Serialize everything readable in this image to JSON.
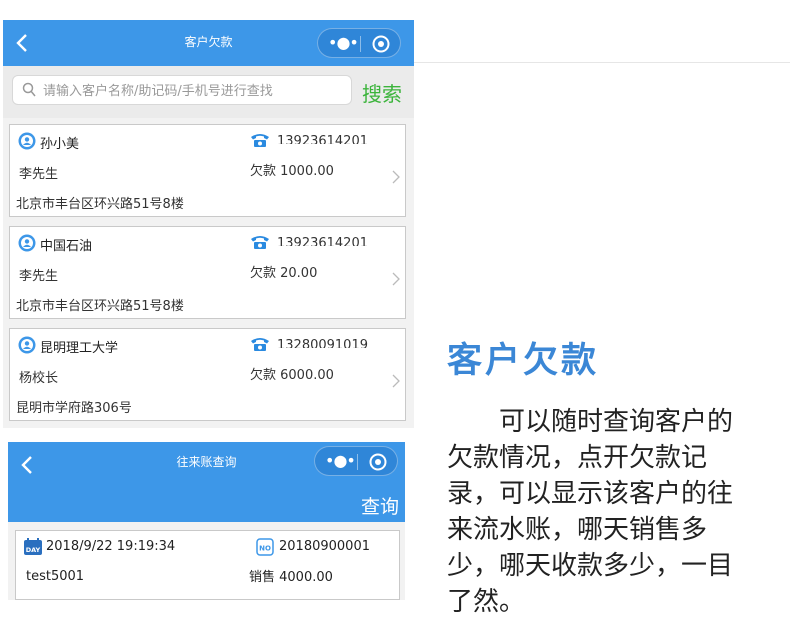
{
  "screen1": {
    "title": "客户欠款",
    "search": {
      "placeholder": "请输入客户名称/助记码/手机号进行查找",
      "button": "搜索"
    },
    "customers": [
      {
        "name": "孙小美",
        "phone": "13923614201",
        "contact": "李先生",
        "debt": "欠款 1000.00",
        "address": "北京市丰台区环兴路51号8楼"
      },
      {
        "name": "中国石油",
        "phone": "13923614201",
        "contact": "李先生",
        "debt": "欠款 20.00",
        "address": "北京市丰台区环兴路51号8楼"
      },
      {
        "name": "昆明理工大学",
        "phone": "13280091019",
        "contact": "杨校长",
        "debt": "欠款 6000.00",
        "address": "昆明市学府路306号"
      }
    ]
  },
  "screen2": {
    "title": "往来账查询",
    "query_button": "查询",
    "record": {
      "datetime": "2018/9/22 19:19:34",
      "order_no": "20180900001",
      "user": "test5001",
      "sale": "销售 4000.00",
      "day_badge": "DAY",
      "no_badge": "NO"
    }
  },
  "promo": {
    "headline": "客户欠款",
    "description": "可以随时查询客户的欠款情况，点开欠款记录，可以显示该客户的往来流水账，哪天销售多少，哪天收款多少，一目了然。"
  },
  "icons": {
    "back": "chevron-left-icon",
    "more": "more-dots-icon",
    "target": "target-icon",
    "search": "search-icon",
    "person": "person-icon",
    "phone": "phone-icon",
    "chevron": "chevron-right-icon",
    "calendar": "calendar-day-icon",
    "number": "number-badge-icon"
  },
  "colors": {
    "nav_blue": "#3d97e8",
    "search_green": "#3cb43c",
    "headline_blue": "#3b87d6"
  }
}
